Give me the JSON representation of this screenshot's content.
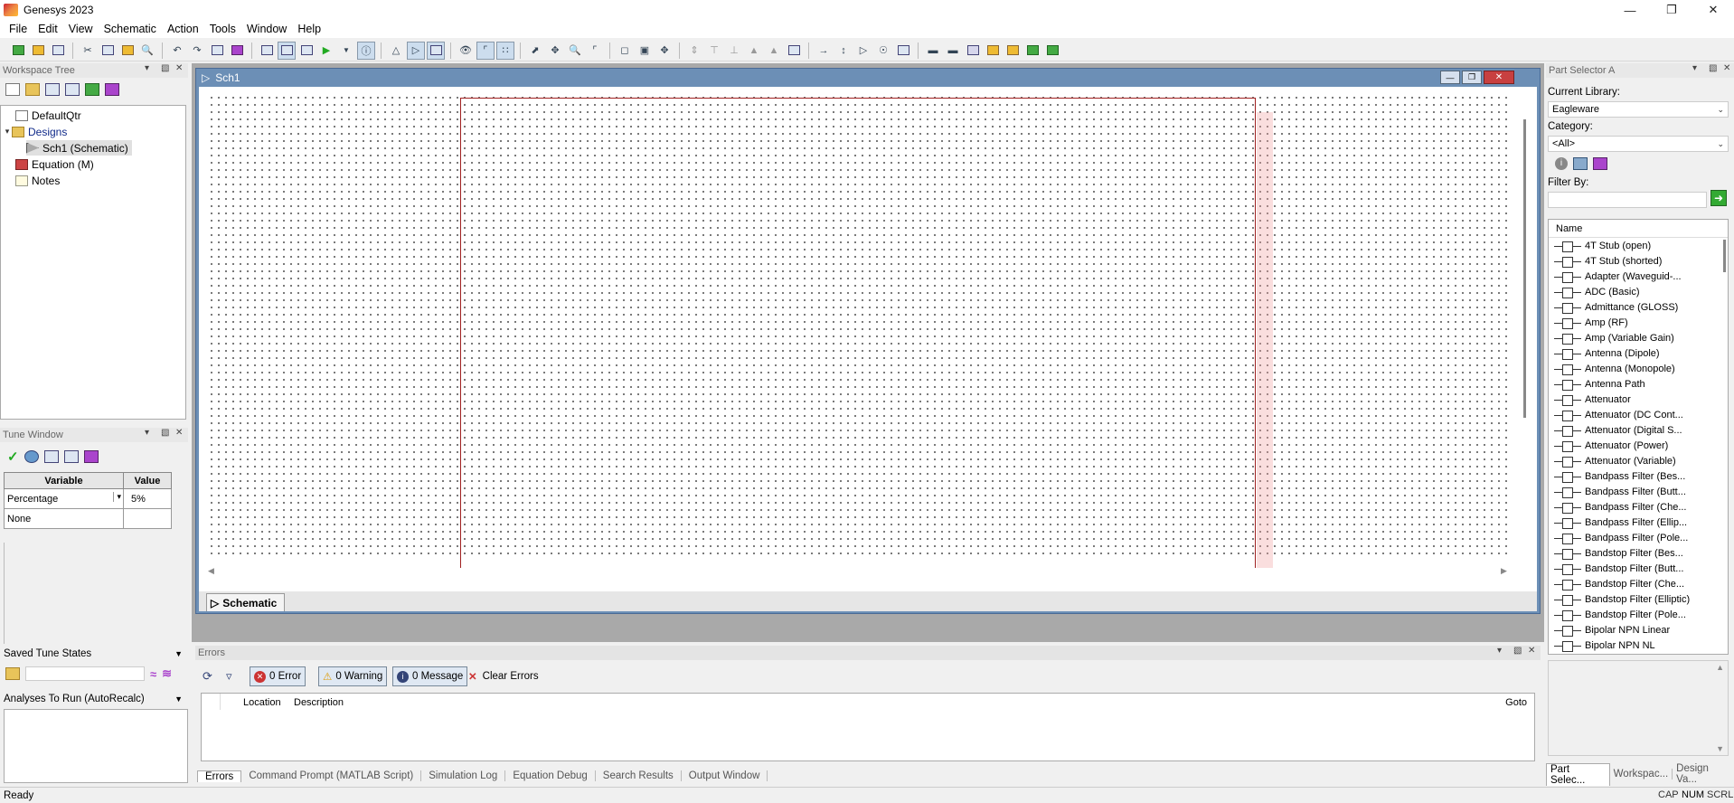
{
  "window": {
    "title": "Genesys 2023",
    "controls": [
      "minimize",
      "maximize",
      "close"
    ]
  },
  "menu": [
    "File",
    "Edit",
    "View",
    "Schematic",
    "Action",
    "Tools",
    "Window",
    "Help"
  ],
  "workspace_tree": {
    "title": "Workspace Tree",
    "items": [
      {
        "label": "DefaultQtr",
        "level": 0,
        "icon": "workspace-icon"
      },
      {
        "label": "Designs",
        "level": 0,
        "icon": "folder-icon"
      },
      {
        "label": "Sch1 (Schematic)",
        "level": 1,
        "icon": "schematic-icon",
        "selected": true
      },
      {
        "label": "Equation (M)",
        "level": 0,
        "icon": "equation-icon"
      },
      {
        "label": "Notes",
        "level": 0,
        "icon": "notes-icon"
      }
    ]
  },
  "tune_window": {
    "title": "Tune Window",
    "columns": [
      "Variable",
      "Value"
    ],
    "rows": [
      {
        "variable": "Percentage",
        "value": "5%"
      },
      {
        "variable": "None",
        "value": ""
      }
    ]
  },
  "saved_tune_states": {
    "title": "Saved Tune States"
  },
  "analyses": {
    "title": "Analyses To Run (AutoRecalc)"
  },
  "schematic": {
    "title": "Sch1",
    "tab_label": "Schematic"
  },
  "errors_panel": {
    "title": "Errors",
    "error_btn": "0 Error",
    "warning_btn": "0 Warning",
    "message_btn": "0 Message",
    "clear_btn": "Clear Errors",
    "columns": [
      "Location",
      "Description",
      "Goto"
    ],
    "tabs": [
      "Errors",
      "Command Prompt (MATLAB Script)",
      "Simulation Log",
      "Equation Debug",
      "Search Results",
      "Output Window"
    ]
  },
  "part_selector": {
    "title": "Part Selector A",
    "library_label": "Current Library:",
    "library_value": "Eagleware",
    "category_label": "Category:",
    "category_value": "<All>",
    "filter_label": "Filter By:",
    "list_header": "Name",
    "parts": [
      "4T Stub (open)",
      "4T Stub (shorted)",
      "Adapter (Waveguid-...",
      "ADC (Basic)",
      "Admittance (GLOSS)",
      "Amp (RF)",
      "Amp (Variable Gain)",
      "Antenna (Dipole)",
      "Antenna (Monopole)",
      "Antenna Path",
      "Attenuator",
      "Attenuator (DC Cont...",
      "Attenuator (Digital S...",
      "Attenuator (Power)",
      "Attenuator (Variable)",
      "Bandpass Filter (Bes...",
      "Bandpass Filter (Butt...",
      "Bandpass Filter (Che...",
      "Bandpass Filter (Ellip...",
      "Bandpass Filter (Pole...",
      "Bandstop Filter (Bes...",
      "Bandstop Filter (Butt...",
      "Bandstop Filter (Che...",
      "Bandstop Filter (Elliptic)",
      "Bandstop Filter (Pole...",
      "Bipolar NPN Linear",
      "Bipolar NPN NL"
    ],
    "bottom_tabs": [
      "Part Selec...",
      "Workspac...",
      "Design Va..."
    ]
  },
  "status": {
    "text": "Ready",
    "indicators": [
      "CAP",
      "NUM",
      "SCRL"
    ]
  }
}
